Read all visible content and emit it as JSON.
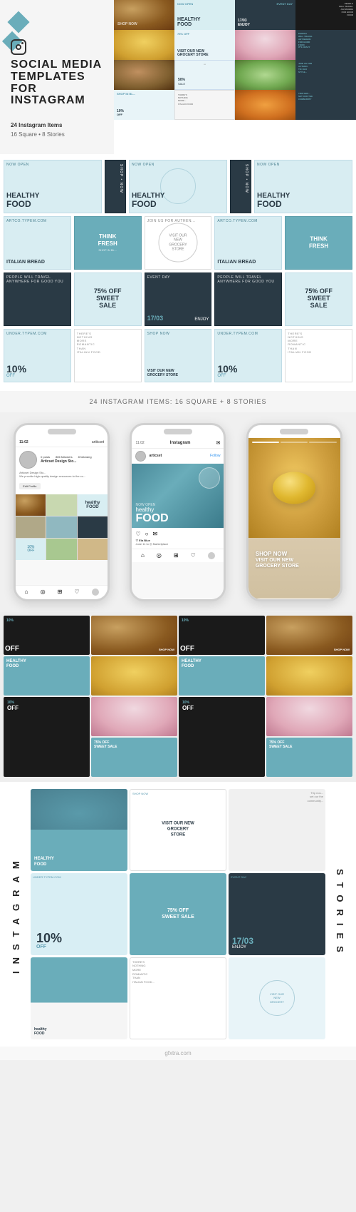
{
  "page": {
    "title": "Social Media Templates for Instagram",
    "subtitle": "Templates for Instagram",
    "items_count": "24 Instagram Items",
    "items_detail": "16 Square • 8 Stories",
    "items_label_2": "24 Instagram Items: 16 Square + 8 Stories",
    "watermark": "gfxtra.com",
    "instagram_icon": "instagram-icon"
  },
  "food_labels": {
    "healthy": "healthy",
    "food": "FOOD",
    "now_open": "NOW OPEN",
    "think_fresh": "THINK FRESH",
    "italian_bread": "ITALIAN BREAD",
    "percent_75": "75% OFF",
    "sweet_sale": "SWEET SALE",
    "percent_50": "50%",
    "percent_10": "10%",
    "off": "OFF",
    "sale": "SALE",
    "shop_now": "SHOP NOW",
    "visit_store": "VISIT OUR NEW GROCERY STORE",
    "event_day": "EVENT DAY",
    "enjoy": "ENJOY",
    "date": "17/03",
    "join_us": "JOIN US FOR AUTHEN...",
    "nothing_more": "THERE'S NOTHING MORE ROMANTIC THAN ITALIAN FOOD"
  },
  "phone_mockups": [
    {
      "id": "phone-1",
      "handle": "artiicset",
      "screen_type": "profile",
      "followers": "806",
      "following": "8",
      "posts": "0"
    },
    {
      "id": "phone-2",
      "handle": "Instagram",
      "screen_type": "post",
      "content": "healthy FOOD",
      "sub": "NOW OPEN"
    },
    {
      "id": "phone-3",
      "handle": "",
      "screen_type": "story",
      "content": "VISIT OUR NEW GROCERY STORE",
      "sub": "SHOP NOW"
    }
  ],
  "sections": {
    "instagram_stories_label": "INSTAGRAM",
    "stories_label": "STORIES",
    "template_rows_label": "24 INSTAGRAM ITEMS: 16 SQUARE + 8 STORIES"
  },
  "colors": {
    "teal": "#6aadba",
    "dark": "#2a3a45",
    "light_bg": "#e8f4f8",
    "accent": "#5a9ab0",
    "yellow": "#f0d060",
    "white": "#ffffff",
    "dark_food": "#1a1a1a"
  }
}
